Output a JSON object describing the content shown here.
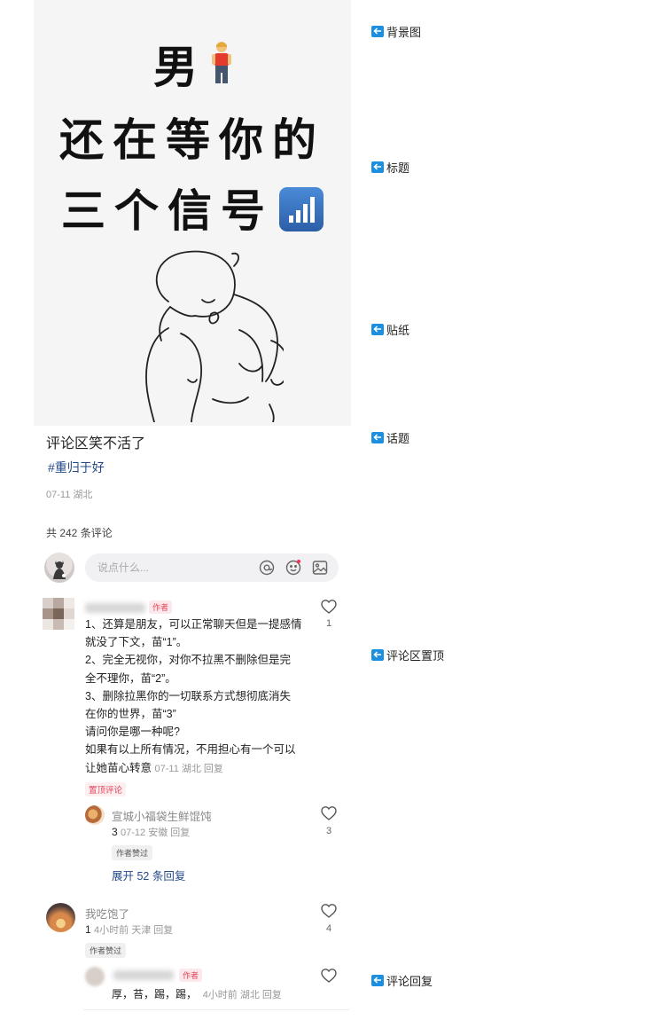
{
  "hero": {
    "line1": "男",
    "line2": "还在等你的",
    "line3": "三个信号"
  },
  "post": {
    "title": "评论区笑不活了",
    "hashtag": "#重归于好",
    "meta": "07-11 湖北",
    "comment_count": "共 242 条评论"
  },
  "input": {
    "placeholder": "说点什么..."
  },
  "comments": [
    {
      "author_badge": "作者",
      "lines": [
        "1、还算是朋友，可以正常聊天但是一提感情",
        "就没了下文，苗“1”。",
        "2、完全无视你，对你不拉黑不删除但是完",
        "全不理你，苗“2”。",
        "3、删除拉黑你的一切联系方式想彻底消失",
        "在你的世界，苗“3”",
        "请问你是哪一种呢?",
        "如果有以上所有情况，不用担心有一个可以"
      ],
      "last_line": "让她苗心转意",
      "meta": "07-11 湖北 回复",
      "pin_badge": "置顶评论",
      "likes": "1",
      "reply": {
        "name": "宣城小福袋生鲜馄饨",
        "text": "3",
        "meta": "07-12 安徽 回复",
        "likes": "3"
      },
      "author_liked": "作者赞过",
      "expand": "展开 52 条回复"
    },
    {
      "name": "我吃饱了",
      "text": "1",
      "meta": "4小时前 天津 回复",
      "likes": "4",
      "author_liked": "作者赞过",
      "reply": {
        "author_badge": "作者",
        "text": "厚，苔，踢，踢，",
        "meta": "4小时前 湖北 回复"
      }
    }
  ],
  "annotations": [
    "背景图",
    "标题",
    "贴纸",
    "话题",
    "评论区置顶",
    "评论回复"
  ],
  "colors": {
    "annotation_icon": "#1d8fe0",
    "hashtag": "#244a8a",
    "author_badge": "#e0445a",
    "meta_text": "#999999"
  }
}
